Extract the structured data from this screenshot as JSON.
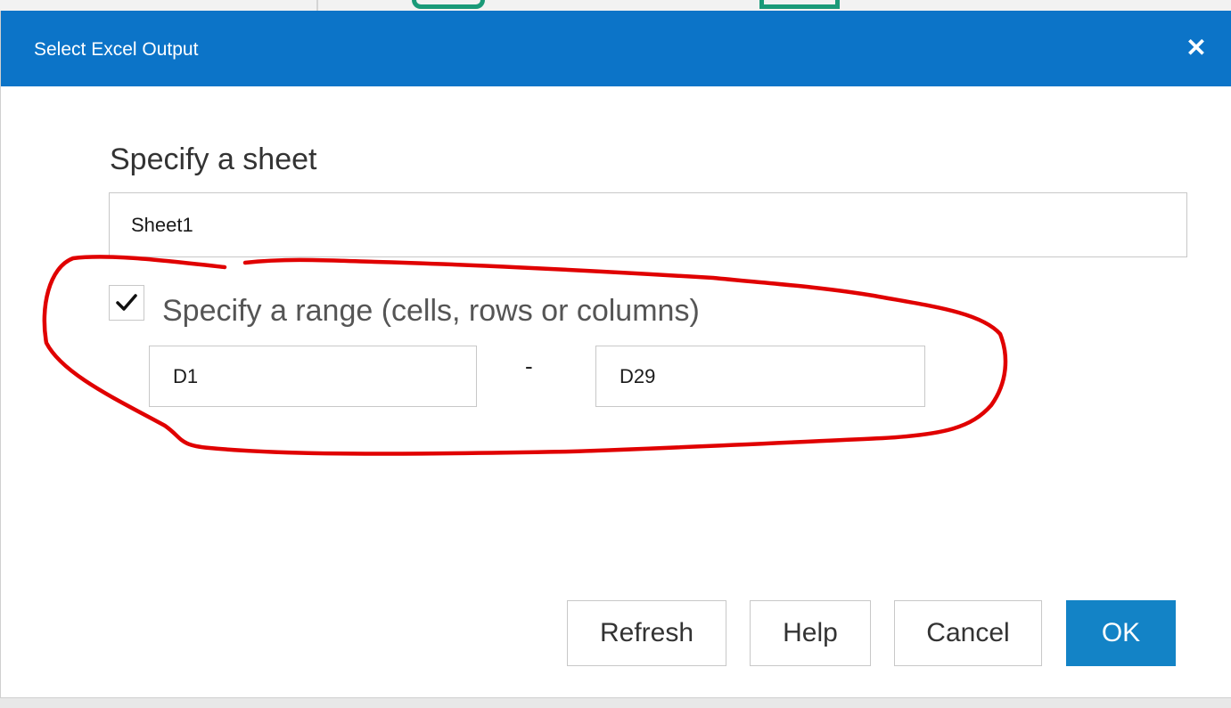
{
  "window": {
    "title": "Select Excel Output",
    "close_icon": "close-icon",
    "title_bar_color": "#0c74c8"
  },
  "sheet": {
    "label": "Specify a sheet",
    "value": "Sheet1"
  },
  "range": {
    "checkbox_checked": true,
    "label": "Specify a range (cells, rows or columns)",
    "from_value": "D1",
    "separator": "-",
    "to_value": "D29"
  },
  "buttons": {
    "refresh": "Refresh",
    "help": "Help",
    "cancel": "Cancel",
    "ok": "OK",
    "ok_color": "#1383c6"
  },
  "annotation": {
    "type": "hand-drawn-circle",
    "color": "#e00000"
  }
}
